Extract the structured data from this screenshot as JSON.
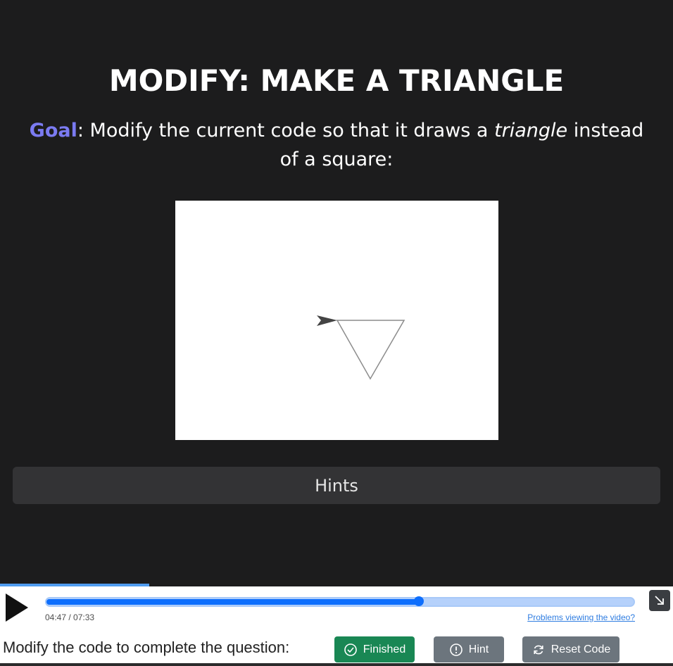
{
  "activity": {
    "title": "MODIFY: MAKE A TRIANGLE",
    "goal_label": "Goal",
    "goal_text_before": ": Modify the current code so that it draws a ",
    "goal_text_emphasis": "triangle",
    "goal_text_after": " instead of a square:",
    "hints_label": "Hints"
  },
  "video": {
    "current_time": "04:47",
    "total_time": "07:33",
    "time_separator": " / ",
    "progress_fraction": 0.634,
    "problems_link": "Problems viewing the video?"
  },
  "footer": {
    "instruction": "Modify the code to complete the question:",
    "finished_label": "Finished",
    "hint_label": "Hint",
    "reset_label": "Reset Code"
  },
  "colors": {
    "background": "#1c1c1d",
    "goal_accent": "#7b7bf2",
    "finished_button": "#198754",
    "secondary_button": "#6c757d",
    "progress": "#0d6efd"
  },
  "icons": {
    "play": "play-icon",
    "expand": "arrow-down-right-icon",
    "finished": "check-circle-icon",
    "hint": "exclamation-circle-icon",
    "reset": "refresh-icon",
    "turtle": "turtle-arrow-icon"
  }
}
